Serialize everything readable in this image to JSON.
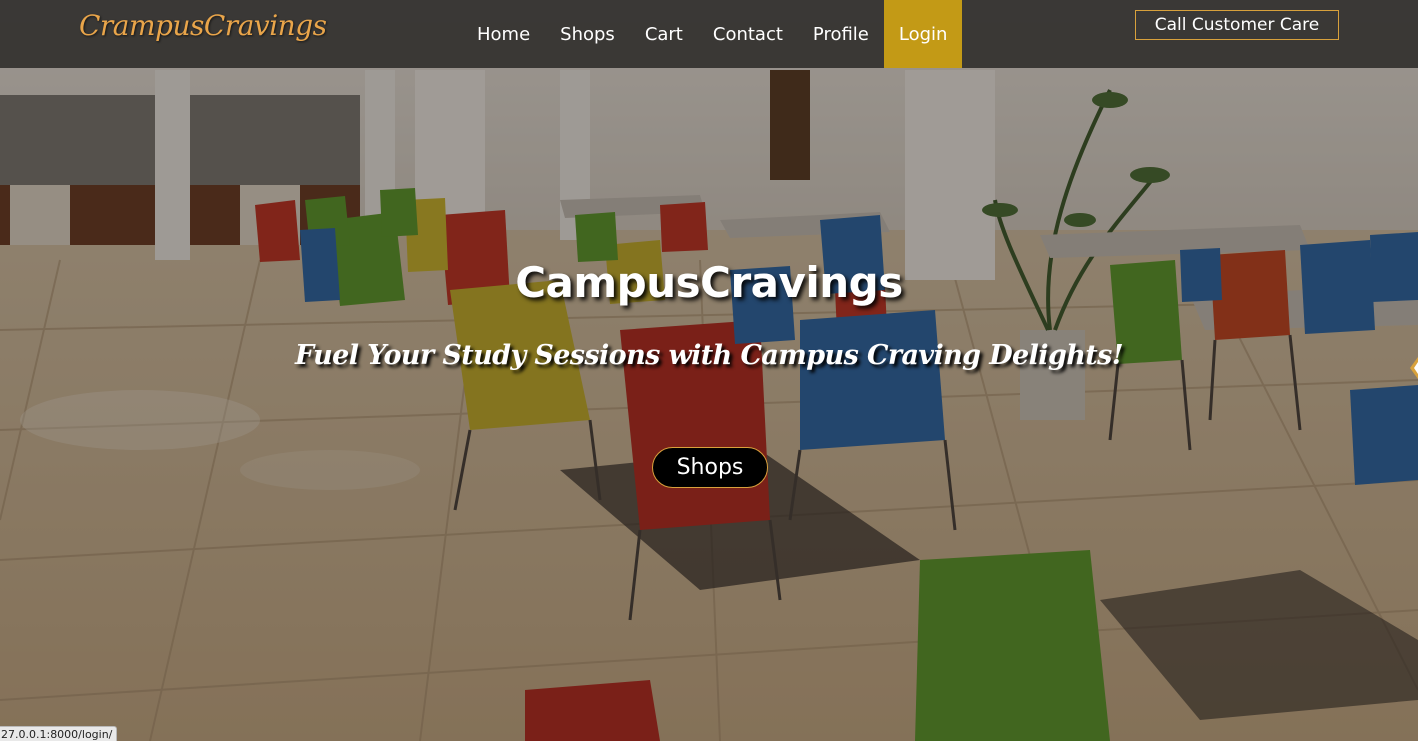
{
  "brand": {
    "name": "CrampusCravings"
  },
  "nav": {
    "items": [
      {
        "label": "Home"
      },
      {
        "label": "Shops"
      },
      {
        "label": "Cart"
      },
      {
        "label": "Contact"
      },
      {
        "label": "Profile"
      },
      {
        "label": "Login",
        "active": true
      }
    ],
    "call_button": "Call Customer Care"
  },
  "hero": {
    "title": "CampusCravings",
    "subtitle": "Fuel Your Study Sessions with Campus Craving Delights!",
    "button": "Shops"
  },
  "status_bar": {
    "url": "27.0.0.1:8000/login/"
  },
  "colors": {
    "navbar": "#343230",
    "brand": "#e9a54a",
    "active_nav": "#c39a16",
    "button_border": "#d8a13c",
    "hero_button": "#000000"
  },
  "icons": {
    "carousel_next": "chevron-right-icon"
  }
}
